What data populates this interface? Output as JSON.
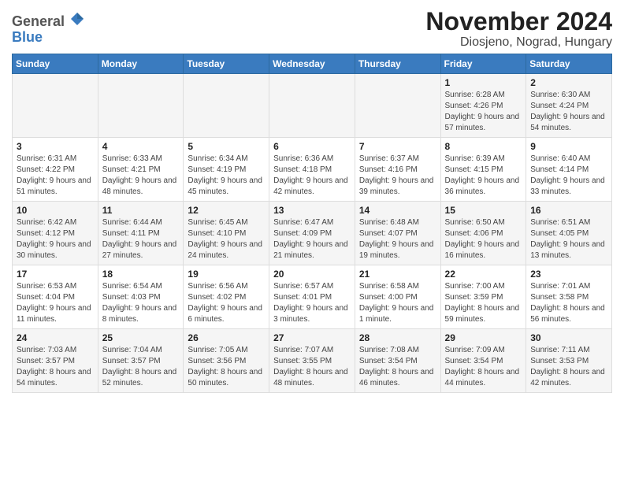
{
  "header": {
    "logo_general": "General",
    "logo_blue": "Blue",
    "title": "November 2024",
    "subtitle": "Diosjeno, Nograd, Hungary"
  },
  "weekdays": [
    "Sunday",
    "Monday",
    "Tuesday",
    "Wednesday",
    "Thursday",
    "Friday",
    "Saturday"
  ],
  "weeks": [
    [
      {
        "day": "",
        "sunrise": "",
        "sunset": "",
        "daylight": ""
      },
      {
        "day": "",
        "sunrise": "",
        "sunset": "",
        "daylight": ""
      },
      {
        "day": "",
        "sunrise": "",
        "sunset": "",
        "daylight": ""
      },
      {
        "day": "",
        "sunrise": "",
        "sunset": "",
        "daylight": ""
      },
      {
        "day": "",
        "sunrise": "",
        "sunset": "",
        "daylight": ""
      },
      {
        "day": "1",
        "sunrise": "Sunrise: 6:28 AM",
        "sunset": "Sunset: 4:26 PM",
        "daylight": "Daylight: 9 hours and 57 minutes."
      },
      {
        "day": "2",
        "sunrise": "Sunrise: 6:30 AM",
        "sunset": "Sunset: 4:24 PM",
        "daylight": "Daylight: 9 hours and 54 minutes."
      }
    ],
    [
      {
        "day": "3",
        "sunrise": "Sunrise: 6:31 AM",
        "sunset": "Sunset: 4:22 PM",
        "daylight": "Daylight: 9 hours and 51 minutes."
      },
      {
        "day": "4",
        "sunrise": "Sunrise: 6:33 AM",
        "sunset": "Sunset: 4:21 PM",
        "daylight": "Daylight: 9 hours and 48 minutes."
      },
      {
        "day": "5",
        "sunrise": "Sunrise: 6:34 AM",
        "sunset": "Sunset: 4:19 PM",
        "daylight": "Daylight: 9 hours and 45 minutes."
      },
      {
        "day": "6",
        "sunrise": "Sunrise: 6:36 AM",
        "sunset": "Sunset: 4:18 PM",
        "daylight": "Daylight: 9 hours and 42 minutes."
      },
      {
        "day": "7",
        "sunrise": "Sunrise: 6:37 AM",
        "sunset": "Sunset: 4:16 PM",
        "daylight": "Daylight: 9 hours and 39 minutes."
      },
      {
        "day": "8",
        "sunrise": "Sunrise: 6:39 AM",
        "sunset": "Sunset: 4:15 PM",
        "daylight": "Daylight: 9 hours and 36 minutes."
      },
      {
        "day": "9",
        "sunrise": "Sunrise: 6:40 AM",
        "sunset": "Sunset: 4:14 PM",
        "daylight": "Daylight: 9 hours and 33 minutes."
      }
    ],
    [
      {
        "day": "10",
        "sunrise": "Sunrise: 6:42 AM",
        "sunset": "Sunset: 4:12 PM",
        "daylight": "Daylight: 9 hours and 30 minutes."
      },
      {
        "day": "11",
        "sunrise": "Sunrise: 6:44 AM",
        "sunset": "Sunset: 4:11 PM",
        "daylight": "Daylight: 9 hours and 27 minutes."
      },
      {
        "day": "12",
        "sunrise": "Sunrise: 6:45 AM",
        "sunset": "Sunset: 4:10 PM",
        "daylight": "Daylight: 9 hours and 24 minutes."
      },
      {
        "day": "13",
        "sunrise": "Sunrise: 6:47 AM",
        "sunset": "Sunset: 4:09 PM",
        "daylight": "Daylight: 9 hours and 21 minutes."
      },
      {
        "day": "14",
        "sunrise": "Sunrise: 6:48 AM",
        "sunset": "Sunset: 4:07 PM",
        "daylight": "Daylight: 9 hours and 19 minutes."
      },
      {
        "day": "15",
        "sunrise": "Sunrise: 6:50 AM",
        "sunset": "Sunset: 4:06 PM",
        "daylight": "Daylight: 9 hours and 16 minutes."
      },
      {
        "day": "16",
        "sunrise": "Sunrise: 6:51 AM",
        "sunset": "Sunset: 4:05 PM",
        "daylight": "Daylight: 9 hours and 13 minutes."
      }
    ],
    [
      {
        "day": "17",
        "sunrise": "Sunrise: 6:53 AM",
        "sunset": "Sunset: 4:04 PM",
        "daylight": "Daylight: 9 hours and 11 minutes."
      },
      {
        "day": "18",
        "sunrise": "Sunrise: 6:54 AM",
        "sunset": "Sunset: 4:03 PM",
        "daylight": "Daylight: 9 hours and 8 minutes."
      },
      {
        "day": "19",
        "sunrise": "Sunrise: 6:56 AM",
        "sunset": "Sunset: 4:02 PM",
        "daylight": "Daylight: 9 hours and 6 minutes."
      },
      {
        "day": "20",
        "sunrise": "Sunrise: 6:57 AM",
        "sunset": "Sunset: 4:01 PM",
        "daylight": "Daylight: 9 hours and 3 minutes."
      },
      {
        "day": "21",
        "sunrise": "Sunrise: 6:58 AM",
        "sunset": "Sunset: 4:00 PM",
        "daylight": "Daylight: 9 hours and 1 minute."
      },
      {
        "day": "22",
        "sunrise": "Sunrise: 7:00 AM",
        "sunset": "Sunset: 3:59 PM",
        "daylight": "Daylight: 8 hours and 59 minutes."
      },
      {
        "day": "23",
        "sunrise": "Sunrise: 7:01 AM",
        "sunset": "Sunset: 3:58 PM",
        "daylight": "Daylight: 8 hours and 56 minutes."
      }
    ],
    [
      {
        "day": "24",
        "sunrise": "Sunrise: 7:03 AM",
        "sunset": "Sunset: 3:57 PM",
        "daylight": "Daylight: 8 hours and 54 minutes."
      },
      {
        "day": "25",
        "sunrise": "Sunrise: 7:04 AM",
        "sunset": "Sunset: 3:57 PM",
        "daylight": "Daylight: 8 hours and 52 minutes."
      },
      {
        "day": "26",
        "sunrise": "Sunrise: 7:05 AM",
        "sunset": "Sunset: 3:56 PM",
        "daylight": "Daylight: 8 hours and 50 minutes."
      },
      {
        "day": "27",
        "sunrise": "Sunrise: 7:07 AM",
        "sunset": "Sunset: 3:55 PM",
        "daylight": "Daylight: 8 hours and 48 minutes."
      },
      {
        "day": "28",
        "sunrise": "Sunrise: 7:08 AM",
        "sunset": "Sunset: 3:54 PM",
        "daylight": "Daylight: 8 hours and 46 minutes."
      },
      {
        "day": "29",
        "sunrise": "Sunrise: 7:09 AM",
        "sunset": "Sunset: 3:54 PM",
        "daylight": "Daylight: 8 hours and 44 minutes."
      },
      {
        "day": "30",
        "sunrise": "Sunrise: 7:11 AM",
        "sunset": "Sunset: 3:53 PM",
        "daylight": "Daylight: 8 hours and 42 minutes."
      }
    ]
  ]
}
